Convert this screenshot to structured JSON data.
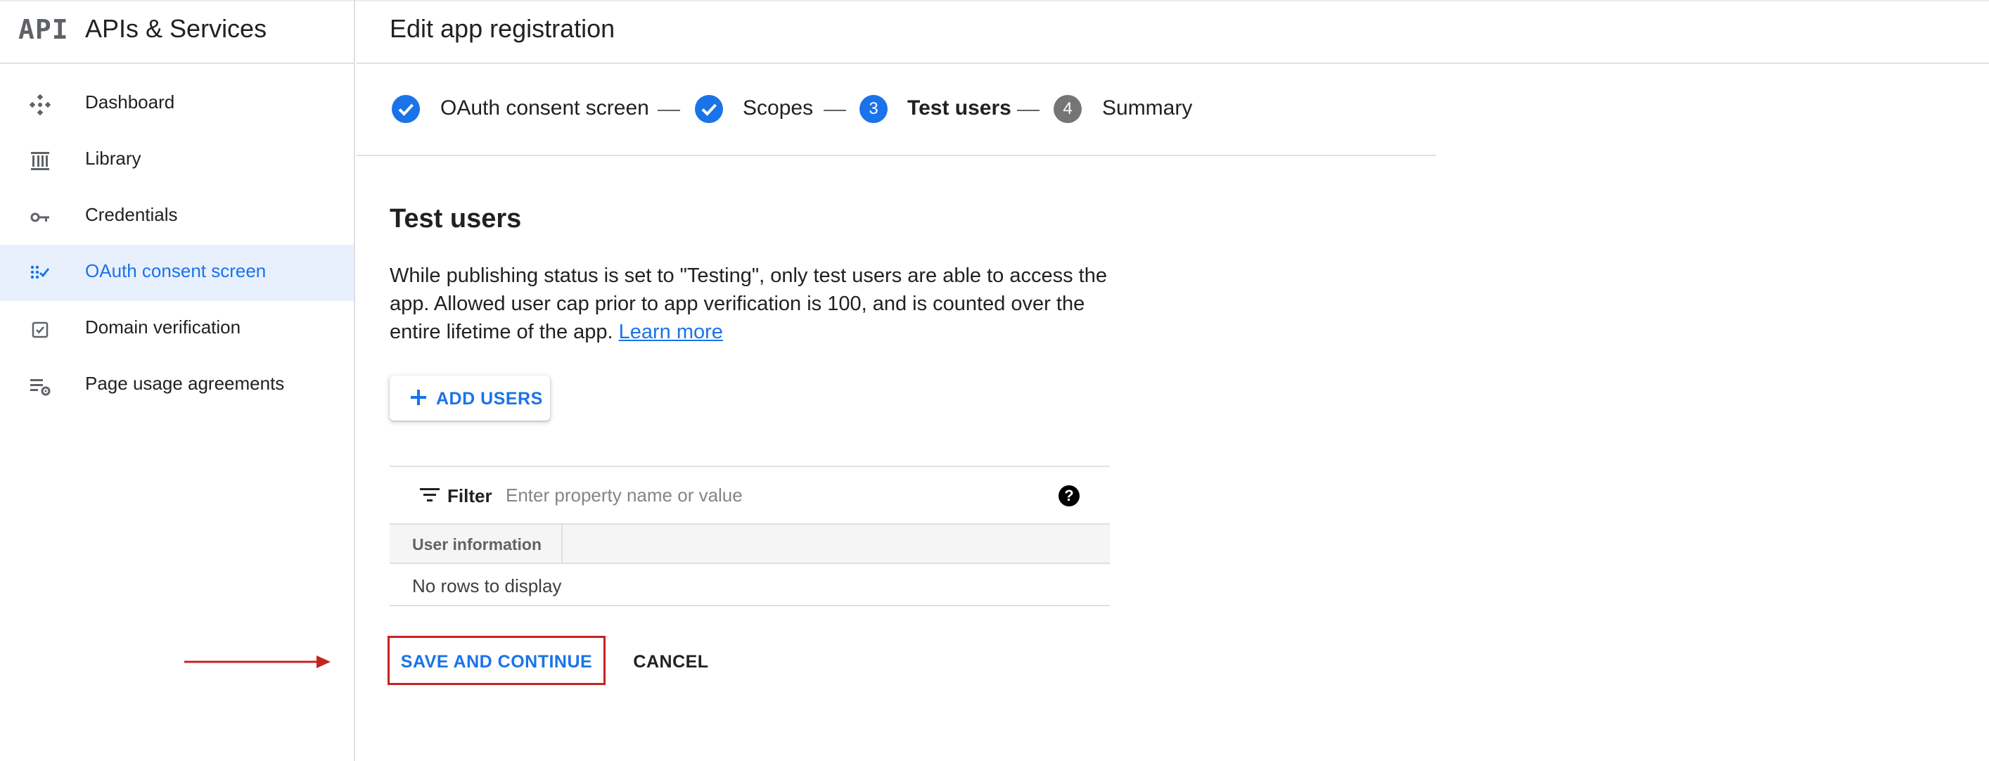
{
  "sidebar": {
    "logo_text": "API",
    "title": "APIs & Services",
    "items": [
      {
        "label": "Dashboard",
        "icon": "dashboard-icon",
        "active": false
      },
      {
        "label": "Library",
        "icon": "library-icon",
        "active": false
      },
      {
        "label": "Credentials",
        "icon": "key-icon",
        "active": false
      },
      {
        "label": "OAuth consent screen",
        "icon": "oauth-consent-icon",
        "active": true
      },
      {
        "label": "Domain verification",
        "icon": "checkbox-icon",
        "active": false
      },
      {
        "label": "Page usage agreements",
        "icon": "settings-list-icon",
        "active": false
      }
    ]
  },
  "header": {
    "title": "Edit app registration"
  },
  "stepper": {
    "steps": [
      {
        "label": "OAuth consent screen",
        "state": "done",
        "number": ""
      },
      {
        "label": "Scopes",
        "state": "done",
        "number": ""
      },
      {
        "label": "Test users",
        "state": "current",
        "number": "3"
      },
      {
        "label": "Summary",
        "state": "upcoming",
        "number": "4"
      }
    ]
  },
  "test_users": {
    "title": "Test users",
    "description": "While publishing status is set to \"Testing\", only test users are able to access the app. Allowed user cap prior to app verification is 100, and is counted over the entire lifetime of the app.",
    "learn_more": "Learn more",
    "add_users_label": "ADD USERS"
  },
  "table": {
    "filter_label": "Filter",
    "filter_placeholder": "Enter property name or value",
    "filter_value": "",
    "help_glyph": "?",
    "columns": [
      "User information"
    ],
    "empty_text": "No rows to display"
  },
  "actions": {
    "save_label": "SAVE AND CONTINUE",
    "cancel_label": "CANCEL"
  },
  "colors": {
    "accent": "#1a73e8",
    "active_nav_bg": "#e8f0fe",
    "highlight_border": "#c5221f",
    "step_upcoming": "#757575"
  }
}
